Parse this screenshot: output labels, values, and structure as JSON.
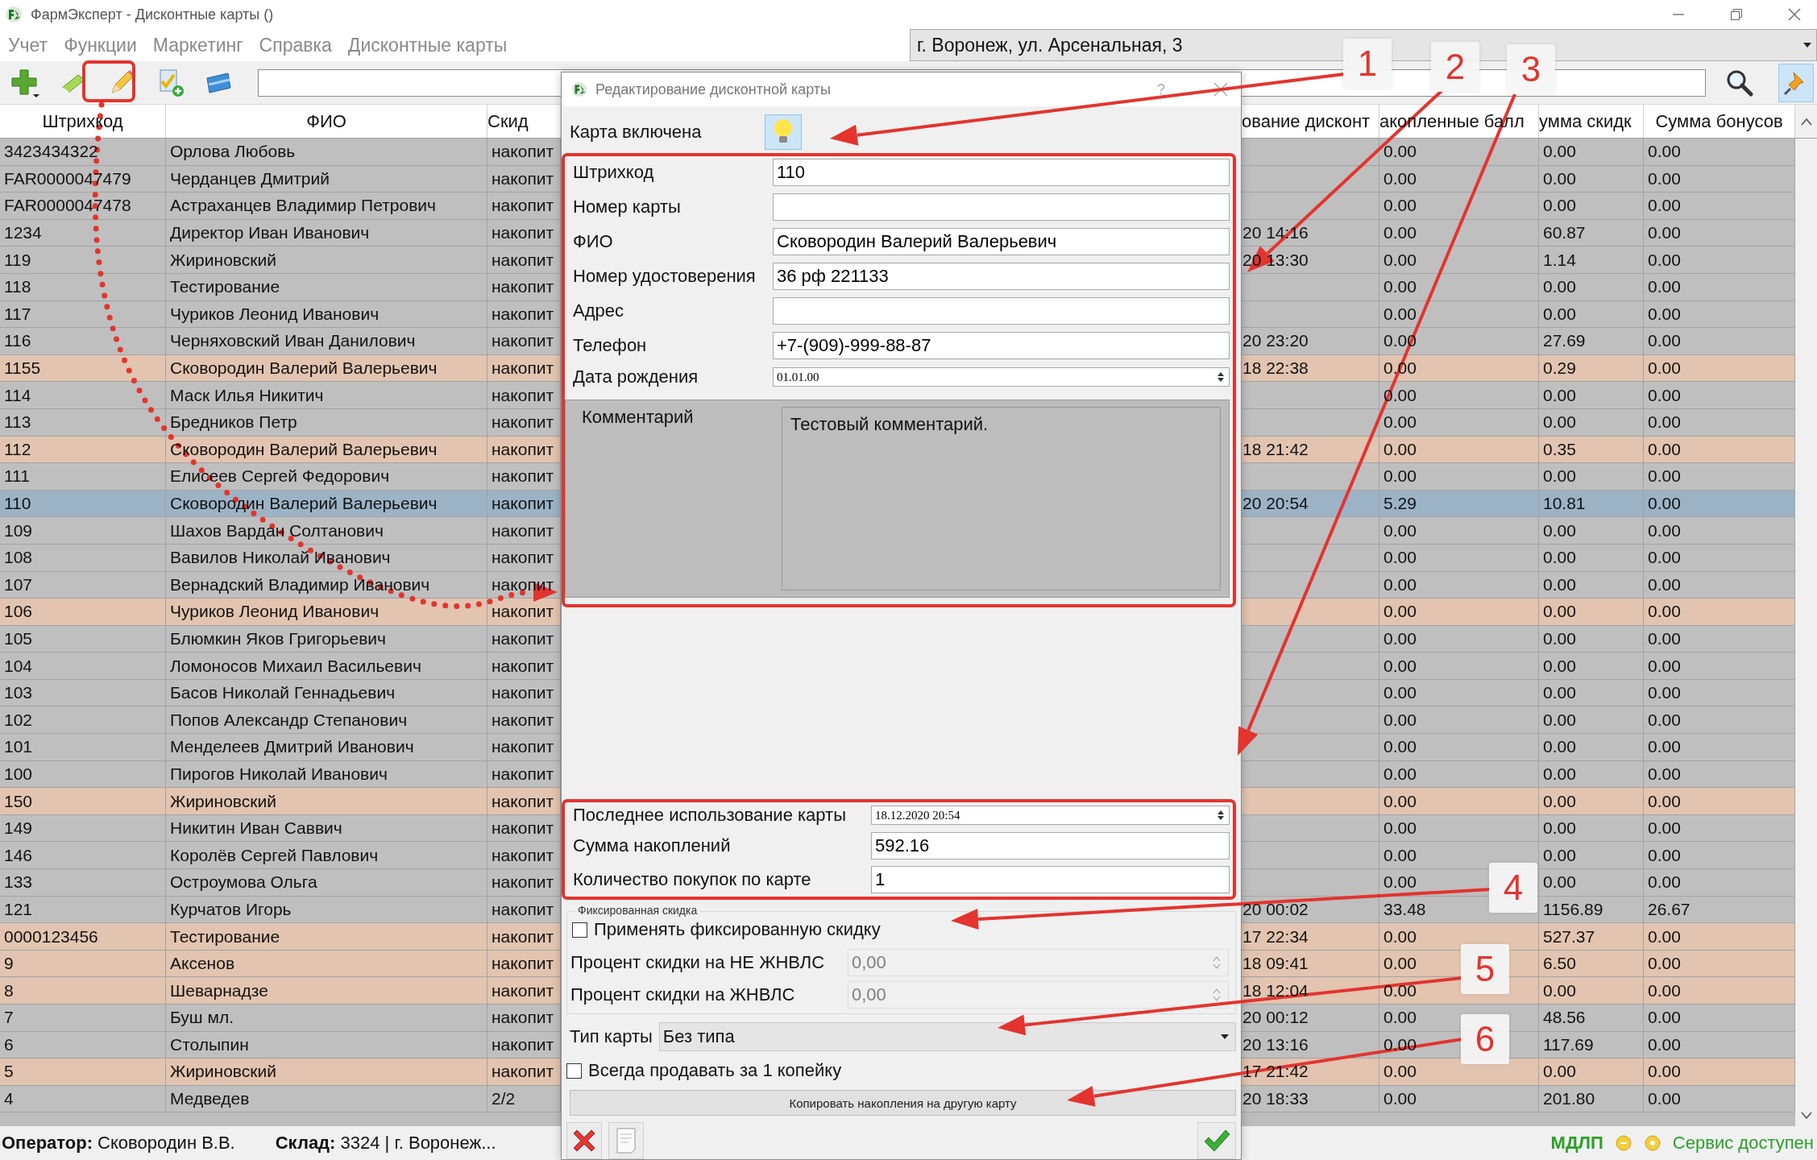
{
  "window": {
    "title": "ФармЭксперт - Дисконтные карты ()"
  },
  "menu": [
    "Учет",
    "Функции",
    "Маркетинг",
    "Справка",
    "Дисконтные карты"
  ],
  "location": {
    "value": "г. Воронеж, ул. Арсенальная, 3"
  },
  "toolbar": {
    "buttons": [
      {
        "kind": "add"
      },
      {
        "kind": "erase"
      },
      {
        "kind": "edit"
      },
      {
        "kind": "approve"
      },
      {
        "kind": "card"
      }
    ]
  },
  "table": {
    "columns": [
      "Штрихкод",
      "ФИО",
      "Скид",
      "ование дисконт",
      "акопленные балл",
      "умма скидк",
      "Сумма бонусов"
    ],
    "rows": [
      {
        "barcode": "3423434322",
        "name": "Орлова Любовь",
        "column_3": "накопит",
        "column_5": "0.00",
        "column_6": "0.00",
        "bonus_sum": "0.00",
        "highlighted": false,
        "selected": false
      },
      {
        "barcode": "FAR0000047479",
        "name": "Черданцев Дмитрий",
        "column_3": "накопит",
        "column_5": "0.00",
        "column_6": "0.00",
        "bonus_sum": "0.00",
        "highlighted": false,
        "selected": false
      },
      {
        "barcode": "FAR0000047478",
        "name": "Астраханцев Владимир Петрович",
        "column_3": "накопит",
        "column_5": "0.00",
        "column_6": "0.00",
        "bonus_sum": "0.00",
        "highlighted": false,
        "selected": false
      },
      {
        "barcode": "1234",
        "name": "Директор Иван Иванович",
        "column_3": "накопит",
        "column_4": "20 14:16",
        "column_5": "0.00",
        "column_6": "60.87",
        "bonus_sum": "0.00",
        "highlighted": false,
        "selected": false
      },
      {
        "barcode": "119",
        "name": "Жириновский",
        "column_3": "накопит",
        "column_4": "20 13:30",
        "column_5": "0.00",
        "column_6": "1.14",
        "bonus_sum": "0.00",
        "highlighted": false,
        "selected": false
      },
      {
        "barcode": "118",
        "name": "Тестирование",
        "column_3": "накопит",
        "column_5": "0.00",
        "column_6": "0.00",
        "bonus_sum": "0.00",
        "highlighted": false,
        "selected": false
      },
      {
        "barcode": "117",
        "name": "Чуриков Леонид Иванович",
        "column_3": "накопит",
        "column_5": "0.00",
        "column_6": "0.00",
        "bonus_sum": "0.00",
        "highlighted": false,
        "selected": false
      },
      {
        "barcode": "116",
        "name": "Черняховский Иван Данилович",
        "column_3": "накопит",
        "column_4": "20 23:20",
        "column_5": "0.00",
        "column_6": "27.69",
        "bonus_sum": "0.00",
        "highlighted": false,
        "selected": false
      },
      {
        "barcode": "1155",
        "name": "Сковородин Валерий Валерьевич",
        "column_3": "накопит",
        "column_4": "18 22:38",
        "column_5": "0.00",
        "column_6": "0.29",
        "bonus_sum": "0.00",
        "highlighted": true,
        "selected": false
      },
      {
        "barcode": "114",
        "name": "Маск Илья Никитич",
        "column_3": "накопит",
        "column_5": "0.00",
        "column_6": "0.00",
        "bonus_sum": "0.00",
        "highlighted": false,
        "selected": false
      },
      {
        "barcode": "113",
        "name": "Бредников Петр",
        "column_3": "накопит",
        "column_5": "0.00",
        "column_6": "0.00",
        "bonus_sum": "0.00",
        "highlighted": false,
        "selected": false
      },
      {
        "barcode": "112",
        "name": "Сковородин Валерий Валерьевич",
        "column_3": "накопит",
        "column_4": "18 21:42",
        "column_5": "0.00",
        "column_6": "0.35",
        "bonus_sum": "0.00",
        "highlighted": true,
        "selected": false
      },
      {
        "barcode": "111",
        "name": "Елисеев Сергей Федорович",
        "column_3": "накопит",
        "column_5": "0.00",
        "column_6": "0.00",
        "bonus_sum": "0.00",
        "highlighted": false,
        "selected": false
      },
      {
        "barcode": "110",
        "name": "Сковородин Валерий Валерьевич",
        "column_3": "накопит",
        "column_4": "20 20:54",
        "column_5": "5.29",
        "column_6": "10.81",
        "bonus_sum": "0.00",
        "highlighted": false,
        "selected": true
      },
      {
        "barcode": "109",
        "name": "Шахов Вардан Солтанович",
        "column_3": "накопит",
        "column_5": "0.00",
        "column_6": "0.00",
        "bonus_sum": "0.00",
        "highlighted": false,
        "selected": false
      },
      {
        "barcode": "108",
        "name": "Вавилов Николай Иванович",
        "column_3": "накопит",
        "column_5": "0.00",
        "column_6": "0.00",
        "bonus_sum": "0.00",
        "highlighted": false,
        "selected": false
      },
      {
        "barcode": "107",
        "name": "Вернадский Владимир Иванович",
        "column_3": "накопит",
        "column_5": "0.00",
        "column_6": "0.00",
        "bonus_sum": "0.00",
        "highlighted": false,
        "selected": false
      },
      {
        "barcode": "106",
        "name": "Чуриков Леонид Иванович",
        "column_3": "накопит",
        "column_5": "0.00",
        "column_6": "0.00",
        "bonus_sum": "0.00",
        "highlighted": true,
        "selected": false
      },
      {
        "barcode": "105",
        "name": "Блюмкин Яков Григорьевич",
        "column_3": "накопит",
        "column_5": "0.00",
        "column_6": "0.00",
        "bonus_sum": "0.00",
        "highlighted": false,
        "selected": false
      },
      {
        "barcode": "104",
        "name": "Ломоносов Михаил Васильевич",
        "column_3": "накопит",
        "column_5": "0.00",
        "column_6": "0.00",
        "bonus_sum": "0.00",
        "highlighted": false,
        "selected": false
      },
      {
        "barcode": "103",
        "name": "Басов Николай Геннадьевич",
        "column_3": "накопит",
        "column_5": "0.00",
        "column_6": "0.00",
        "bonus_sum": "0.00",
        "highlighted": false,
        "selected": false
      },
      {
        "barcode": "102",
        "name": "Попов Александр Степанович",
        "column_3": "накопит",
        "column_5": "0.00",
        "column_6": "0.00",
        "bonus_sum": "0.00",
        "highlighted": false,
        "selected": false
      },
      {
        "barcode": "101",
        "name": "Менделеев Дмитрий Иванович",
        "column_3": "накопит",
        "column_5": "0.00",
        "column_6": "0.00",
        "bonus_sum": "0.00",
        "highlighted": false,
        "selected": false
      },
      {
        "barcode": "100",
        "name": "Пирогов Николай Иванович",
        "column_3": "накопит",
        "column_5": "0.00",
        "column_6": "0.00",
        "bonus_sum": "0.00",
        "highlighted": false,
        "selected": false
      },
      {
        "barcode": "150",
        "name": "Жириновский",
        "column_3": "накопит",
        "column_5": "0.00",
        "column_6": "0.00",
        "bonus_sum": "0.00",
        "highlighted": true,
        "selected": false
      },
      {
        "barcode": "149",
        "name": "Никитин Иван Саввич",
        "column_3": "накопит",
        "column_5": "0.00",
        "column_6": "0.00",
        "bonus_sum": "0.00",
        "highlighted": false,
        "selected": false
      },
      {
        "barcode": "146",
        "name": "Королёв Сергей Павлович",
        "column_3": "накопит",
        "column_5": "0.00",
        "column_6": "0.00",
        "bonus_sum": "0.00",
        "highlighted": false,
        "selected": false
      },
      {
        "barcode": "133",
        "name": "Остроумова Ольга",
        "column_3": "накопит",
        "column_5": "0.00",
        "column_6": "0.00",
        "bonus_sum": "0.00",
        "highlighted": false,
        "selected": false
      },
      {
        "barcode": "121",
        "name": "Курчатов Игорь",
        "column_3": "накопит",
        "column_4": "20 00:02",
        "column_5": "33.48",
        "column_6": "1156.89",
        "bonus_sum": "26.67",
        "highlighted": false,
        "selected": false
      },
      {
        "barcode": "0000123456",
        "name": "Тестирование",
        "column_3": "накопит",
        "column_4": "17 22:34",
        "column_5": "0.00",
        "column_6": "527.37",
        "bonus_sum": "0.00",
        "highlighted": true,
        "selected": false
      },
      {
        "barcode": "9",
        "name": "Аксенов",
        "column_3": "накопит",
        "column_4": "18 09:41",
        "column_5": "0.00",
        "column_6": "6.50",
        "bonus_sum": "0.00",
        "highlighted": true,
        "selected": false
      },
      {
        "barcode": "8",
        "name": "Шеварнадзе",
        "column_3": "накопит",
        "column_4": "18 12:04",
        "column_5": "0.00",
        "column_6": "0.00",
        "bonus_sum": "0.00",
        "highlighted": true,
        "selected": false
      },
      {
        "barcode": "7",
        "name": "Буш мл.",
        "column_3": "накопит",
        "column_4": "20 00:12",
        "column_5": "0.00",
        "column_6": "48.56",
        "bonus_sum": "0.00",
        "highlighted": false,
        "selected": false
      },
      {
        "barcode": "6",
        "name": "Столыпин",
        "column_3": "накопит",
        "column_4": "20 13:16",
        "column_5": "0.00",
        "column_6": "117.69",
        "bonus_sum": "0.00",
        "highlighted": false,
        "selected": false
      },
      {
        "barcode": "5",
        "name": "Жириновский",
        "column_3": "накопит",
        "column_4": "17 21:42",
        "column_5": "0.00",
        "column_6": "0.00",
        "bonus_sum": "0.00",
        "highlighted": true,
        "selected": false
      },
      {
        "barcode": "4",
        "name": "Медведев",
        "column_3": "2/2",
        "column_4": "20 18:33",
        "column_5": "0.00",
        "column_6": "201.80",
        "bonus_sum": "0.00",
        "highlighted": false,
        "selected": false
      }
    ]
  },
  "dialog": {
    "title": "Редактирование дисконтной карты",
    "help": "?",
    "enabled_toggle": {
      "label": "Карта включена",
      "on": true
    },
    "fields": [
      {
        "label": "Штрихкод",
        "value": "110",
        "kind": "text"
      },
      {
        "label": "Номер карты",
        "kind": "text"
      },
      {
        "label": "ФИО",
        "value": "Сковородин Валерий Валерьевич",
        "kind": "text"
      },
      {
        "label": "Номер удостоверения",
        "value": "36 рф 221133",
        "kind": "text"
      },
      {
        "label": "Адрес",
        "kind": "text"
      },
      {
        "label": "Телефон",
        "value": "+7-(909)-999-88-87",
        "kind": "text"
      },
      {
        "label": "Дата рождения",
        "value": "01.01.00",
        "kind": "date"
      },
      {
        "label": "Комментарий",
        "value": "Тестовый комментарий.",
        "kind": "memo"
      }
    ],
    "stats": [
      {
        "label": "Последнее использование карты",
        "value": "18.12.2020 20:54",
        "kind": "date"
      },
      {
        "label": "Сумма накоплений",
        "value": "592.16",
        "kind": "text"
      },
      {
        "label": "Количество покупок по карте",
        "value": "1",
        "kind": "text"
      }
    ],
    "fixed_discount": {
      "title": "Фиксированная скидка",
      "apply": {
        "label": "Применять фиксированную скидку",
        "checked": false
      },
      "rates": [
        {
          "label": "Процент скидки на НЕ ЖНВЛС",
          "value": "0,00",
          "disabled": true
        },
        {
          "label": "Процент скидки на ЖНВЛС",
          "value": "0,00",
          "disabled": true
        }
      ]
    },
    "card_type": {
      "label": "Тип карты",
      "value": "Без типа"
    },
    "penny_sale": {
      "label": "Всегда продавать за 1 копейку",
      "checked": false
    },
    "copy_button": "Копировать накопления на другую карту",
    "footer_buttons": [
      {
        "kind": "delete"
      },
      {
        "kind": "notes"
      },
      {
        "kind": "ok"
      }
    ]
  },
  "status_bar": {
    "operator": "**Оператор:** Сковородин В.В.",
    "warehouse": "**Склад:** 3324 | г. Воронеж...",
    "mdlp": "МДЛП",
    "service": "Сервис доступен"
  },
  "callouts": [
    "1",
    "2",
    "3",
    "4",
    "5",
    "6"
  ]
}
